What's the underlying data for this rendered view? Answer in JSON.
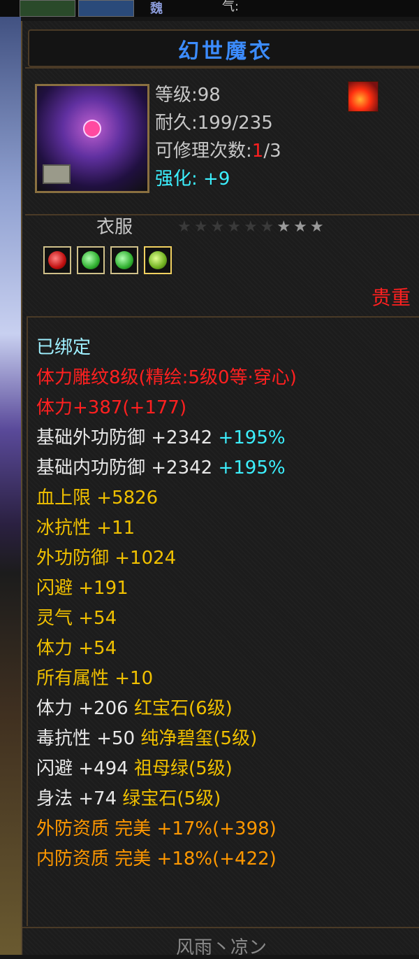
{
  "topbar": {
    "partial_label": "魏",
    "qi_label": "气:"
  },
  "item": {
    "name": "幻世魔衣",
    "level_text": "等级:98",
    "durability_label": "耐久:",
    "durability_value": "199/235",
    "repair_label": "可修理次数:",
    "repair_used": "1",
    "repair_total": "/3",
    "enhance_label": "强化:",
    "enhance_value": "+9",
    "category": "衣服",
    "rarity": "贵重",
    "stars_total": 9,
    "stars_lit": 3
  },
  "gems": [
    {
      "name": "red-gem-icon",
      "color": "#e02020"
    },
    {
      "name": "green-gem-icon",
      "color": "#30c030"
    },
    {
      "name": "green-gem-icon",
      "color": "#30c030"
    },
    {
      "name": "emerald-gem-icon",
      "color": "#a0d030"
    }
  ],
  "attributes": {
    "bound": "已绑定",
    "engrave": "体力雕纹8级(精绘:5级0等·穿心)",
    "stamina_total": "体力+387(+177)",
    "ext_def_base": "基础外功防御 +2342",
    "ext_def_pct": "+195%",
    "int_def_base": "基础内功防御 +2342",
    "int_def_pct": "+195%",
    "hp": "血上限 +5826",
    "ice_res": "冰抗性 +11",
    "ext_def": "外功防御 +1024",
    "dodge": "闪避 +191",
    "spirit": "灵气 +54",
    "stamina": "体力 +54",
    "all_attr": "所有属性 +10",
    "gem1_stat": "体力 +206",
    "gem1_name": "红宝石(6级)",
    "gem2_stat": "毒抗性 +50",
    "gem2_name": "纯净碧玺(5级)",
    "gem3_stat": "闪避 +494",
    "gem3_name": "祖母绿(5级)",
    "gem4_stat": "身法 +74",
    "gem4_name": "绿宝石(5级)",
    "apt_ext": "外防资质 完美 +17%(+398)",
    "apt_int": "内防资质 完美 +18%(+422)"
  },
  "owner": "风雨丶凉ン"
}
